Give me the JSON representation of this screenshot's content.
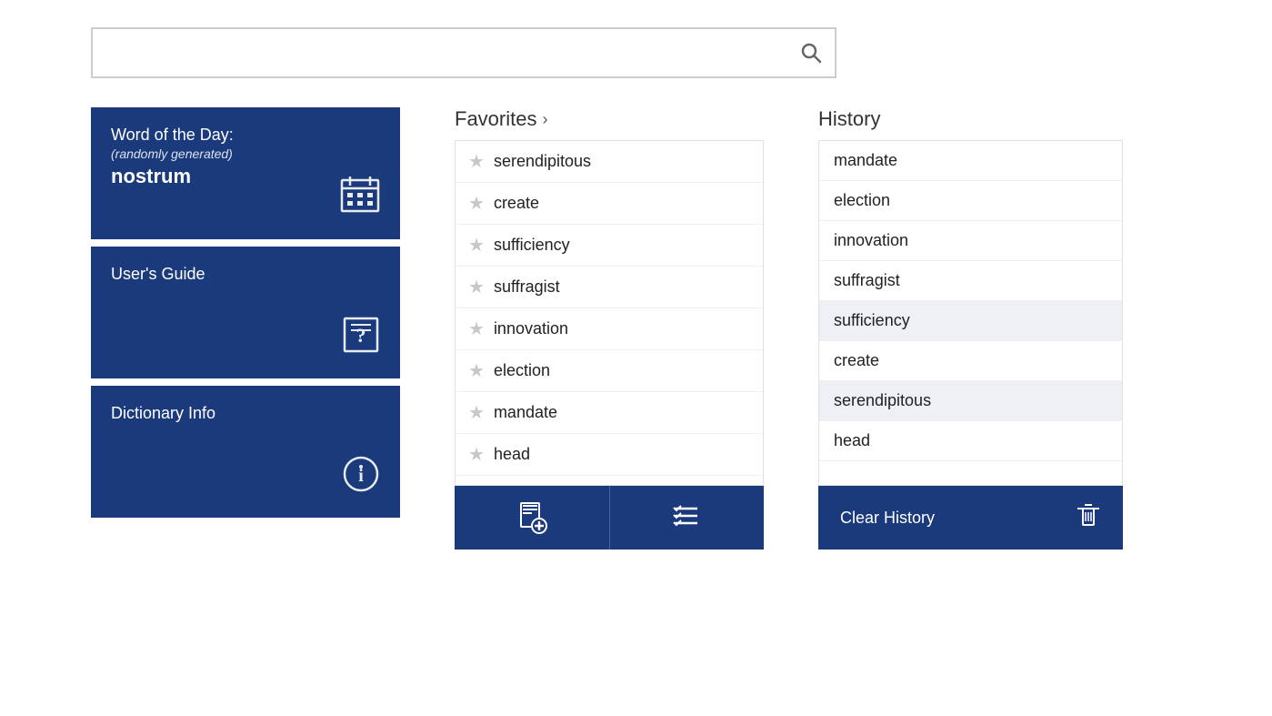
{
  "search": {
    "placeholder": "",
    "value": ""
  },
  "left_tiles": [
    {
      "id": "word-of-day",
      "title": "Word of the Day:",
      "subtitle": "(randomly generated)",
      "word": "nostrum",
      "icon": "calendar"
    },
    {
      "id": "users-guide",
      "title": "User's Guide",
      "subtitle": "",
      "word": "",
      "icon": "help"
    },
    {
      "id": "dictionary-info",
      "title": "Dictionary Info",
      "subtitle": "",
      "word": "",
      "icon": "info"
    }
  ],
  "favorites": {
    "header": "Favorites",
    "chevron": "›",
    "items": [
      "serendipitous",
      "create",
      "sufficiency",
      "suffragist",
      "innovation",
      "election",
      "mandate",
      "head"
    ],
    "add_label": "add",
    "manage_label": "manage"
  },
  "history": {
    "header": "History",
    "items": [
      {
        "word": "mandate",
        "highlighted": false
      },
      {
        "word": "election",
        "highlighted": false
      },
      {
        "word": "innovation",
        "highlighted": false
      },
      {
        "word": "suffragist",
        "highlighted": false
      },
      {
        "word": "sufficiency",
        "highlighted": true
      },
      {
        "word": "create",
        "highlighted": false
      },
      {
        "word": "serendipitous",
        "highlighted": true
      },
      {
        "word": "head",
        "highlighted": false
      }
    ],
    "clear_label": "Clear History"
  }
}
